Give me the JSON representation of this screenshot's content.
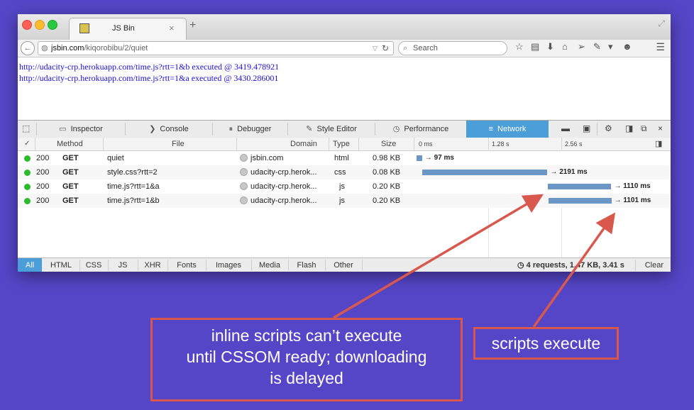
{
  "browser": {
    "tab_title": "JS Bin",
    "url_domain": "jsbin.com",
    "url_path": "/kiqorobibu/2/quiet",
    "search_placeholder": "Search"
  },
  "content": {
    "log_lines": [
      "http://udacity-crp.herokuapp.com/time.js?rtt=1&b executed @ 3419.478921",
      "http://udacity-crp.herokuapp.com/time.js?rtt=1&a executed @ 3430.286001"
    ]
  },
  "devtools": {
    "tabs": [
      "Inspector",
      "Console",
      "Debugger",
      "Style Editor",
      "Performance",
      "Network"
    ],
    "selected_tab": "Network",
    "columns": [
      "Method",
      "File",
      "Domain",
      "Type",
      "Size"
    ],
    "timeline_ticks": [
      "0 ms",
      "1.28 s",
      "2.56 s"
    ],
    "requests": [
      {
        "status": "200",
        "method": "GET",
        "file": "quiet",
        "domain": "jsbin.com",
        "type": "html",
        "size": "0.98 KB",
        "timing": "→ 97 ms",
        "start_s": 0.0,
        "duration_s": 0.097
      },
      {
        "status": "200",
        "method": "GET",
        "file": "style.css?rtt=2",
        "domain": "udacity-crp.herok...",
        "type": "css",
        "size": "0.08 KB",
        "timing": "→ 2191 ms",
        "start_s": 0.1,
        "duration_s": 2.191
      },
      {
        "status": "200",
        "method": "GET",
        "file": "time.js?rtt=1&a",
        "domain": "udacity-crp.herok...",
        "type": "js",
        "size": "0.20 KB",
        "timing": "→ 1110 ms",
        "start_s": 2.3,
        "duration_s": 1.11
      },
      {
        "status": "200",
        "method": "GET",
        "file": "time.js?rtt=1&b",
        "domain": "udacity-crp.herok...",
        "type": "js",
        "size": "0.20 KB",
        "timing": "→ 1101 ms",
        "start_s": 2.31,
        "duration_s": 1.101
      }
    ],
    "filters": [
      "All",
      "HTML",
      "CSS",
      "JS",
      "XHR",
      "Fonts",
      "Images",
      "Media",
      "Flash",
      "Other"
    ],
    "selected_filter": "All",
    "summary": "4 requests, 1.47 KB, 3.41 s",
    "clear_label": "Clear"
  },
  "annotations": {
    "left_lines": [
      "inline scripts can’t execute",
      "until CSSOM ready; downloading",
      "is delayed"
    ],
    "right": "scripts execute",
    "color": "#d9584e"
  },
  "colors": {
    "background": "#5546c8",
    "selection": "#4c9ed9",
    "waterfall_bar": "#6b96c6",
    "status_ok": "#2cbb2a"
  }
}
